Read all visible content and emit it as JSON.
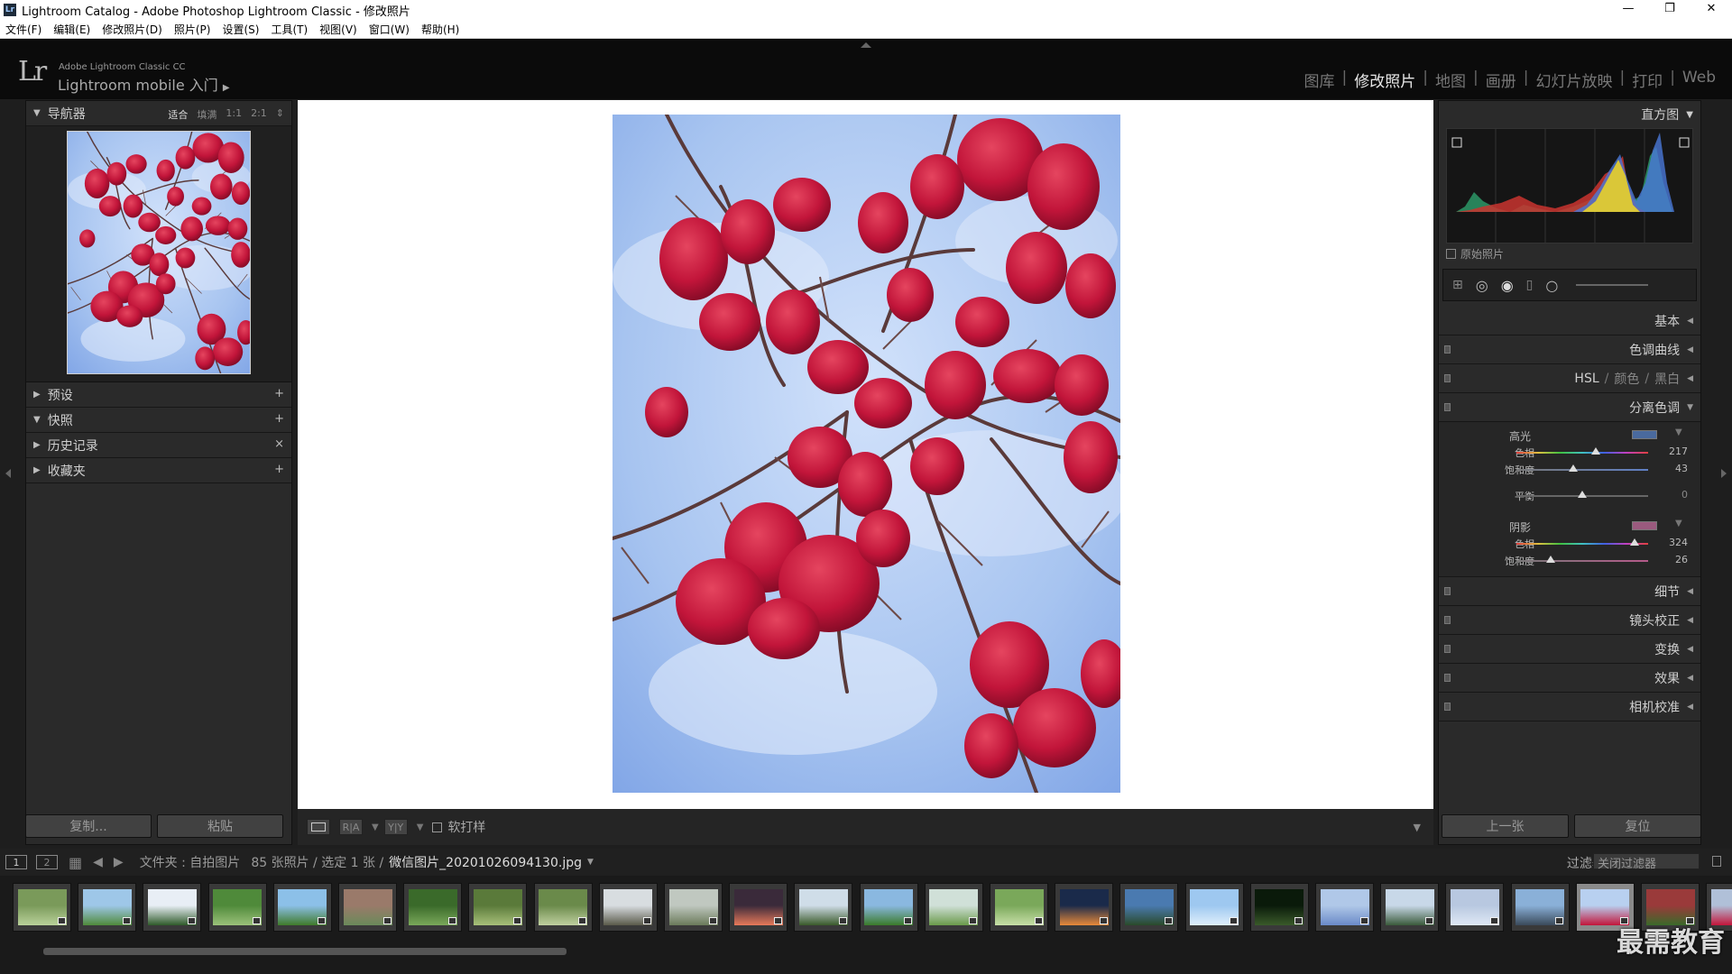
{
  "window": {
    "title": "Lightroom Catalog - Adobe Photoshop Lightroom Classic - 修改照片",
    "controls": [
      "—",
      "❐",
      "✕"
    ]
  },
  "menu": [
    "文件(F)",
    "编辑(E)",
    "修改照片(D)",
    "照片(P)",
    "设置(S)",
    "工具(T)",
    "视图(V)",
    "窗口(W)",
    "帮助(H)"
  ],
  "header": {
    "logo": "Lr",
    "product": "Adobe Lightroom Classic CC",
    "mobile": "Lightroom mobile 入门",
    "modules": [
      "图库",
      "修改照片",
      "地图",
      "画册",
      "幻灯片放映",
      "打印",
      "Web"
    ],
    "active_module": "修改照片"
  },
  "left_panel": {
    "navigator": {
      "title": "导航器",
      "zoom_options": [
        "适合",
        "填满",
        "1:1",
        "2:1"
      ],
      "selected_zoom": "适合"
    },
    "sections": [
      {
        "title": "预设",
        "action": "+"
      },
      {
        "title": "快照",
        "action": "+"
      },
      {
        "title": "历史记录",
        "action": "×"
      },
      {
        "title": "收藏夹",
        "action": "+"
      }
    ],
    "copy_button": "复制...",
    "paste_button": "粘贴"
  },
  "toolbar": {
    "soft_proof": "软打样",
    "view_a": "R|A",
    "view_b": "Y|Y"
  },
  "right_panel": {
    "histogram_title": "直方图",
    "original_photo": "原始照片",
    "panels": [
      "基本",
      "色调曲线"
    ],
    "hsl": {
      "hsl": "HSL",
      "color": "颜色",
      "bw": "黑白"
    },
    "split_toning": {
      "title": "分离色调",
      "highlights": {
        "label": "高光",
        "color": "#4a6a9e",
        "hue_label": "色相",
        "hue": 217,
        "saturation_label": "饱和度",
        "saturation": 43
      },
      "balance": {
        "label": "平衡",
        "value": 0
      },
      "shadows": {
        "label": "阴影",
        "color": "#9a5a7e",
        "hue_label": "色相",
        "hue": 324,
        "saturation_label": "饱和度",
        "saturation": 26
      }
    },
    "more_panels": [
      "细节",
      "镜头校正",
      "变换",
      "效果",
      "相机校准"
    ],
    "prev_button": "上一张",
    "reset_button": "复位"
  },
  "filmstrip": {
    "page1": "1",
    "page2": "2",
    "folder": "文件夹 : 自拍图片",
    "count": "85 张照片 / 选定 1 张 /",
    "filename": "微信图片_20201026094130.jpg",
    "filter_label": "过滤器 :",
    "filter_value": "关闭过滤器",
    "watermark": "最需教育"
  }
}
